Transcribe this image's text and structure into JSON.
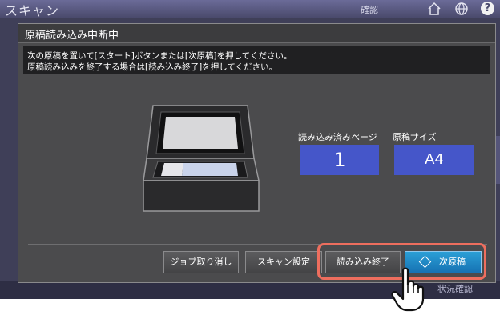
{
  "app": {
    "title": "スキャン",
    "confirm_label": "確認",
    "status_confirm": "状況確認"
  },
  "icons": {
    "home": "home-icon",
    "globe": "globe-icon",
    "help": "help-icon",
    "help_glyph": "?",
    "scanner": "scanner-icon",
    "hand": "hand-pointer-icon"
  },
  "dialog": {
    "title": "原稿読み込み中断中",
    "message_line1": "次の原稿を置いて[スタート]ボタンまたは[次原稿]を押してください。",
    "message_line2": "原稿読み込みを終了する場合は[読み込み終了]を押してください。",
    "pages_label": "読み込み済みページ",
    "pages_value": "1",
    "size_label": "原稿サイズ",
    "size_value": "A4",
    "buttons": {
      "cancel_job": "ジョブ取り消し",
      "scan_settings": "スキャン設定",
      "finish_reading": "読み込み終了",
      "next_original": "次原稿"
    }
  },
  "colors": {
    "accent_blue": "#4556c9",
    "next_button": "#1f8ac8",
    "highlight": "#ee6e5e",
    "dialog_bg": "#4b4b4d"
  }
}
